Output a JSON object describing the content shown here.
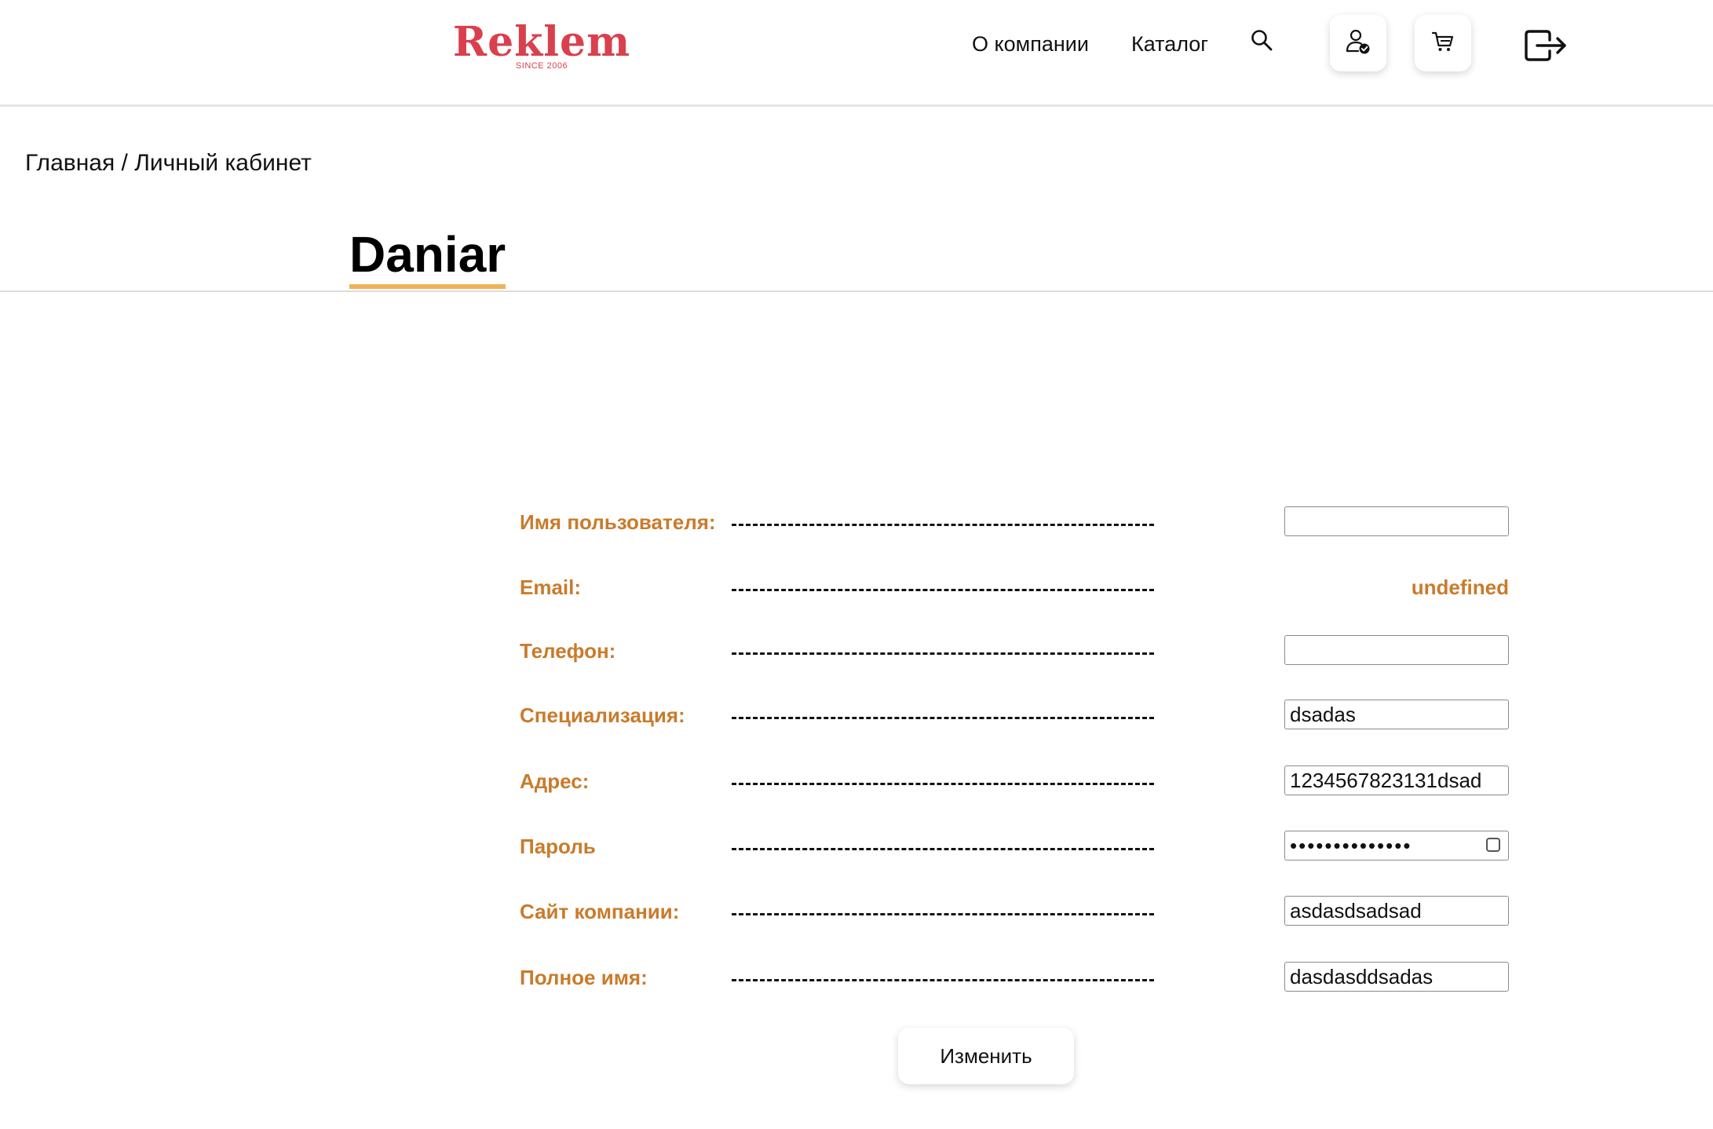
{
  "header": {
    "logo_text": "Reklem",
    "logo_tagline": "SINCE 2006",
    "nav": [
      {
        "label": "О компании"
      },
      {
        "label": "Каталог"
      }
    ],
    "icons": {
      "search": "search-icon",
      "profile": "user-check-icon",
      "cart": "cart-icon",
      "logout": "logout-icon"
    }
  },
  "breadcrumb": {
    "home": "Главная",
    "separator": " / ",
    "current": "Личный кабинет"
  },
  "profile": {
    "title": "Daniar",
    "fields": [
      {
        "label": "Имя пользователя:",
        "type": "input",
        "value": ""
      },
      {
        "label": "Email:",
        "type": "static",
        "value": "undefined"
      },
      {
        "label": "Телефон:",
        "type": "input",
        "value": ""
      },
      {
        "label": "Специализация:",
        "type": "input",
        "value": "dsadas"
      },
      {
        "label": "Адрес:",
        "type": "input",
        "value": "1234567823131dsad"
      },
      {
        "label": "Пароль",
        "type": "password",
        "value": "••••••••••••••"
      },
      {
        "label": "Сайт компании:",
        "type": "input",
        "value": "asdasdsadsad"
      },
      {
        "label": "Полное имя:",
        "type": "input",
        "value": "dasdasddsadas"
      }
    ],
    "submit_label": "Изменить"
  },
  "colors": {
    "brand": "#d9404e",
    "label": "#c97b2b",
    "title_underline": "#f0b35a"
  }
}
